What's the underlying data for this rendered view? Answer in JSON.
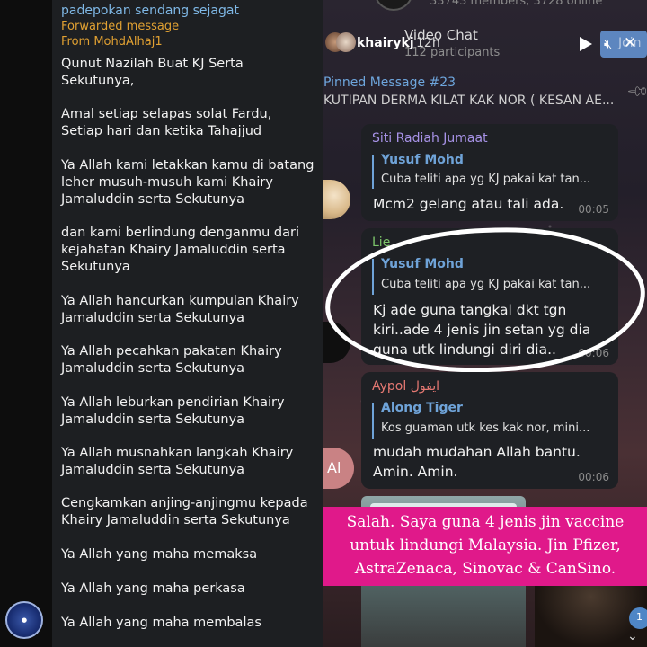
{
  "left_panel": {
    "channel_name": "padepokan sendang sejagat",
    "forwarded_label": "Forwarded message",
    "from_label": "From MohdAlhaj1",
    "paragraphs": [
      [
        "Qunut Nazilah Buat KJ Serta",
        "Sekutunya,"
      ],
      [
        "Amal setiap selapas solat Fardu,",
        "Setiap hari dan ketika Tahajjud"
      ],
      [
        "Ya Allah kami letakkan kamu di batang",
        "leher musuh-musuh kami Khairy",
        "Jamaluddin serta Sekutunya"
      ],
      [
        "dan kami berlindung denganmu dari",
        "kejahatan Khairy Jamaluddin serta",
        "Sekutunya"
      ],
      [
        "Ya Allah hancurkan kumpulan Khairy",
        "Jamaluddin serta Sekutunya"
      ],
      [
        "Ya Allah pecahkan pakatan Khairy",
        "Jamaluddin serta Sekutunya"
      ],
      [
        "Ya Allah leburkan pendirian Khairy",
        "Jamaluddin serta Sekutunya"
      ],
      [
        "Ya Allah musnahkan langkah Khairy",
        "Jamaluddin serta Sekutunya"
      ],
      [
        "Cengkamkan anjing-anjingmu kepada",
        "Khairy Jamaluddin serta Sekutunya"
      ],
      [
        "Ya Allah yang maha memaksa"
      ],
      [
        "Ya Allah yang maha perkasa"
      ],
      [
        "Ya Allah yang maha membalas"
      ]
    ]
  },
  "right_panel": {
    "top_info": "33743 members, 3728 online",
    "instagram_user": "khairykj",
    "instagram_time": "12h",
    "video_chat": {
      "title": "Video Chat",
      "participants": "112 participants",
      "join_label": "Join"
    },
    "pinned": {
      "title": "Pinned Message #23",
      "text": "KUTIPAN DERMA KILAT KAK NOR ( KESAN AE..."
    },
    "messages": [
      {
        "sender": "Siti Radiah Jumaat",
        "sender_color": "#a792e6",
        "quote_name": "Yusuf Mohd",
        "quote_text": "Cuba teliti apa yg KJ pakai kat tan...",
        "body": [
          "Mcm2 gelang atau tali ada."
        ],
        "time": "00:05"
      },
      {
        "sender": "Lie",
        "sender_color": "#7cc46a",
        "quote_name": "Yusuf Mohd",
        "quote_text": "Cuba teliti apa yg KJ pakai kat tan...",
        "body": [
          "Kj ade guna tangkal dkt tgn",
          "kiri..ade 4 jenis jin setan yg dia",
          "guna utk lindungi diri dia.."
        ],
        "time": "00:06"
      },
      {
        "sender": "Aypol ايفول",
        "sender_color": "#e57872",
        "quote_name": "Along Tiger",
        "quote_text": "Kos guaman utk kes kak nor, mini...",
        "body": [
          "mudah mudahan Allah bantu.",
          "Amin. Amin."
        ],
        "time": "00:06"
      }
    ],
    "avatar_initials": "Al",
    "caption_lines": [
      "Salah. Saya guna 4 jenis jin vaccine",
      "untuk lindungi Malaysia. Jin Pfizer,",
      "AstraZenaca, Sinovac & CanSino."
    ],
    "unread_count": "1",
    "colors": {
      "caption_bg": "#e0198a",
      "accent_blue": "#6fa3d8",
      "join_bg": "#5d86bf"
    }
  }
}
